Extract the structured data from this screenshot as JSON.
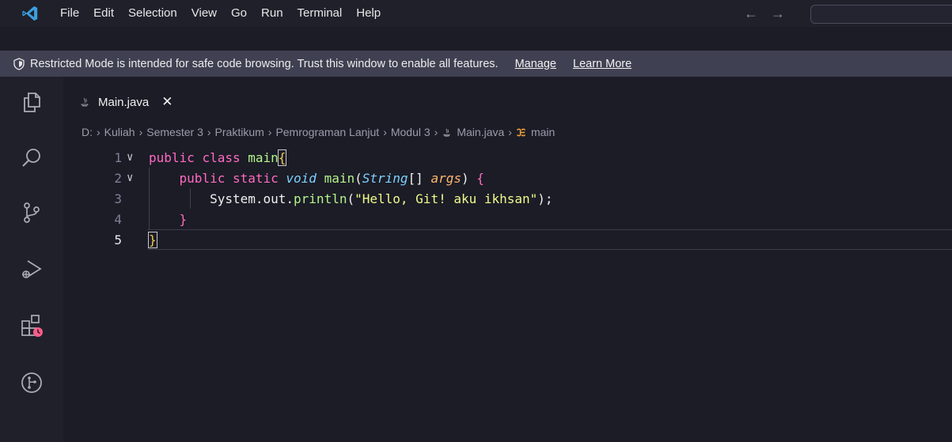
{
  "titlebar": {
    "menu": [
      "File",
      "Edit",
      "Selection",
      "View",
      "Go",
      "Run",
      "Terminal",
      "Help"
    ],
    "back_arrow": "←",
    "forward_arrow": "→"
  },
  "banner": {
    "text": "Restricted Mode is intended for safe code browsing. Trust this window to enable all features.",
    "manage_label": "Manage",
    "learn_more_label": "Learn More"
  },
  "tab": {
    "label": "Main.java",
    "close": "✕"
  },
  "breadcrumb": {
    "items": [
      "D:",
      "Kuliah",
      "Semester 3",
      "Praktikum",
      "Pemrograman Lanjut",
      "Modul 3",
      "Main.java",
      "main"
    ],
    "separator": "›"
  },
  "editor": {
    "line_numbers": [
      "1",
      "2",
      "3",
      "4",
      "5"
    ],
    "current_line": 5,
    "lines": {
      "l1": {
        "kw1": "public",
        "kw2": "class",
        "name": "main",
        "brace": "{"
      },
      "l2": {
        "kw1": "public",
        "kw2": "static",
        "type": "void",
        "fn": "main",
        "paren_open": "(",
        "ptype": "String",
        "arr": "[]",
        "param": "args",
        "paren_close": ")",
        "brace": "{"
      },
      "l3": {
        "obj": "System.out.",
        "fn": "println",
        "open": "(",
        "str": "\"Hello, Git! aku ikhsan\"",
        "close": ");"
      },
      "l4": {
        "brace": "}"
      },
      "l5": {
        "brace": "}"
      }
    }
  },
  "colors": {
    "accent_vscode": "#3b9ede",
    "keyword": "#ff6ac1",
    "string": "#f1fa8c"
  },
  "icons": {
    "activity": [
      "explorer-icon",
      "search-icon",
      "source-control-icon",
      "run-debug-icon",
      "extensions-icon",
      "git-graph-icon"
    ]
  }
}
